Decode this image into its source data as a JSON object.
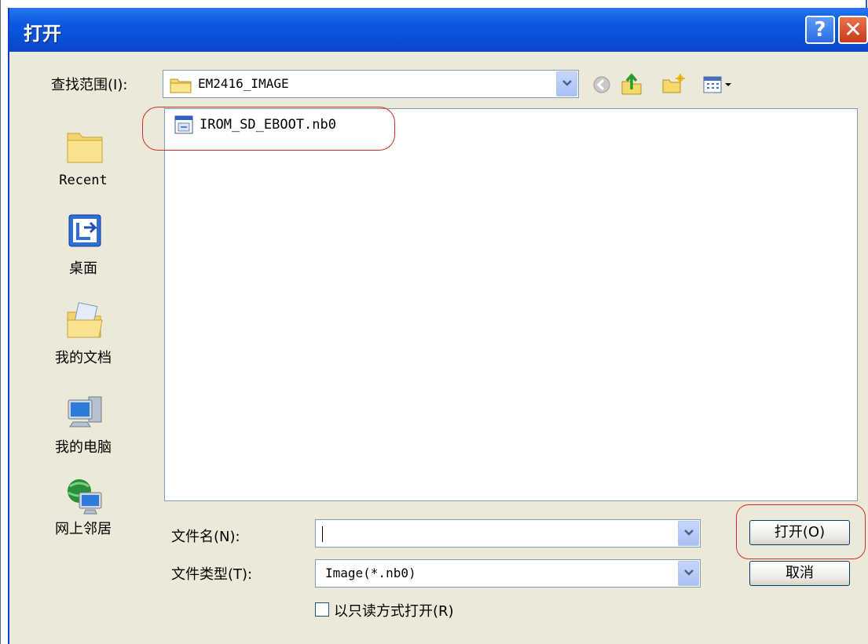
{
  "window": {
    "title": "打开",
    "help_glyph": "?",
    "close_glyph": "✕"
  },
  "lookin": {
    "label": "查找范围(I):",
    "value": "EM2416_IMAGE"
  },
  "places": [
    {
      "label": "Recent",
      "icon": "recent-folder-icon"
    },
    {
      "label": "桌面",
      "icon": "desktop-icon"
    },
    {
      "label": "我的文档",
      "icon": "my-documents-icon"
    },
    {
      "label": "我的电脑",
      "icon": "my-computer-icon"
    },
    {
      "label": "网上邻居",
      "icon": "network-places-icon"
    }
  ],
  "files": [
    {
      "name": "IROM_SD_EBOOT.nb0",
      "icon": "file-icon"
    }
  ],
  "filename": {
    "label": "文件名(N):",
    "value": ""
  },
  "filetype": {
    "label": "文件类型(T):",
    "value": "Image(*.nb0)"
  },
  "readonly": {
    "label": "以只读方式打开(R)",
    "checked": false
  },
  "buttons": {
    "open": "打开(O)",
    "cancel": "取消"
  },
  "colors": {
    "titlebar": "#0a4fd6",
    "dialog_bg": "#ece9d8",
    "highlight": "#d42b2b"
  }
}
